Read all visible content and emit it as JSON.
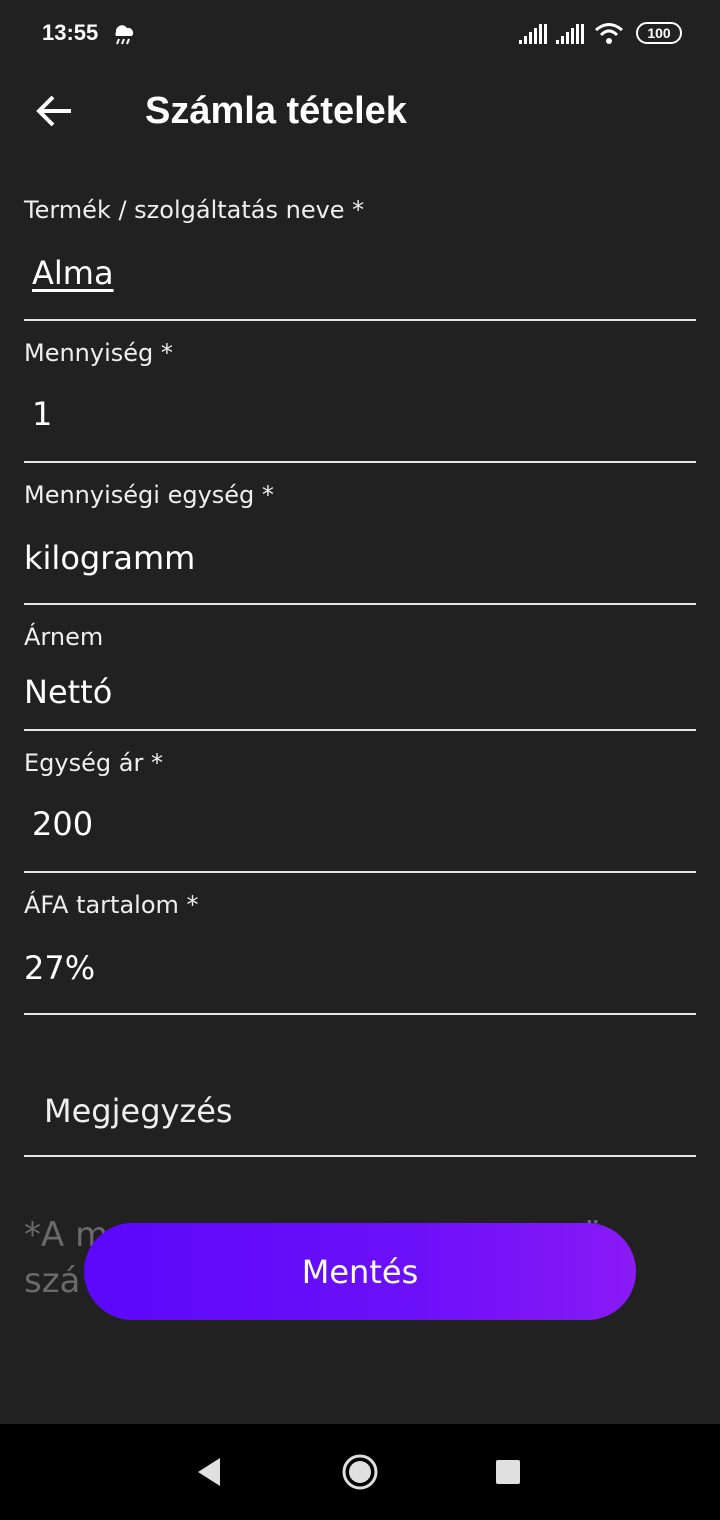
{
  "status_bar": {
    "time": "13:55",
    "battery": "100",
    "icons": [
      "weather-notification-icon",
      "signal-icon-sim1",
      "signal-icon-sim2",
      "wifi-icon",
      "battery-icon"
    ]
  },
  "header": {
    "title": "Számla tételek",
    "back_icon": "arrow-back-icon"
  },
  "form": {
    "product_name": {
      "label": "Termék / szolgáltatás neve *",
      "value": "Alma"
    },
    "quantity": {
      "label": "Mennyiség *",
      "value": "1"
    },
    "unit": {
      "label": "Mennyiségi egység *",
      "value": "kilogramm"
    },
    "price_type": {
      "label": "Árnem",
      "value": "Nettó"
    },
    "unit_price": {
      "label": "Egység ár *",
      "value": "200"
    },
    "vat": {
      "label": "ÁFA tartalom *",
      "value": "27%"
    },
    "note_field": {
      "placeholder": "Megjegyzés"
    }
  },
  "footer_note": {
    "line1": "*A m",
    "line1_end": "ü",
    "line2": "szá"
  },
  "actions": {
    "save_label": "Mentés"
  },
  "colors": {
    "background": "#212121",
    "button_gradient_start": "#5b08fb",
    "button_gradient_end": "#8a1af6",
    "nav_bar": "#000000"
  },
  "nav_bar": {
    "icons": [
      "nav-back-icon",
      "nav-home-icon",
      "nav-recents-icon"
    ]
  }
}
